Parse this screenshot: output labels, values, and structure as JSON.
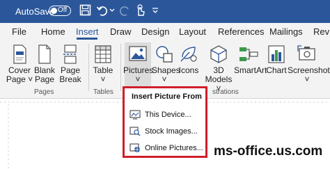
{
  "titlebar": {
    "autosave_label": "AutoSave",
    "toggle_state": "Off",
    "accent": "#2b579a"
  },
  "tabs": [
    {
      "label": "File"
    },
    {
      "label": "Home"
    },
    {
      "label": "Insert"
    },
    {
      "label": "Draw"
    },
    {
      "label": "Design"
    },
    {
      "label": "Layout"
    },
    {
      "label": "References"
    },
    {
      "label": "Mailings"
    },
    {
      "label": "Revi"
    }
  ],
  "active_tab": "Insert",
  "ribbon": {
    "cover_page": {
      "line1": "Cover",
      "line2": "Page ˅"
    },
    "blank_page": {
      "line1": "Blank",
      "line2": "Page"
    },
    "page_break": {
      "line1": "Page",
      "line2": "Break"
    },
    "table": {
      "line1": "Table",
      "line2": "˅"
    },
    "pictures": {
      "line1": "Pictures",
      "line2": "˅"
    },
    "shapes": {
      "line1": "Shapes",
      "line2": "˅"
    },
    "icons": {
      "line1": "Icons"
    },
    "models_3d": {
      "line1": "3D",
      "line2": "Models ˅"
    },
    "smartart": {
      "line1": "SmartArt"
    },
    "chart": {
      "line1": "Chart"
    },
    "screenshot": {
      "line1": "Screenshot",
      "line2": "˅"
    },
    "groups": {
      "pages": "Pages",
      "tables": "Tables",
      "illustrations": "strations"
    }
  },
  "popup": {
    "title": "Insert Picture From",
    "items": [
      {
        "label": "This Device..."
      },
      {
        "label": "Stock Images..."
      },
      {
        "label": "Online Pictures..."
      }
    ],
    "border_color": "#d01f2a"
  },
  "watermark": "ms-office.us.com"
}
